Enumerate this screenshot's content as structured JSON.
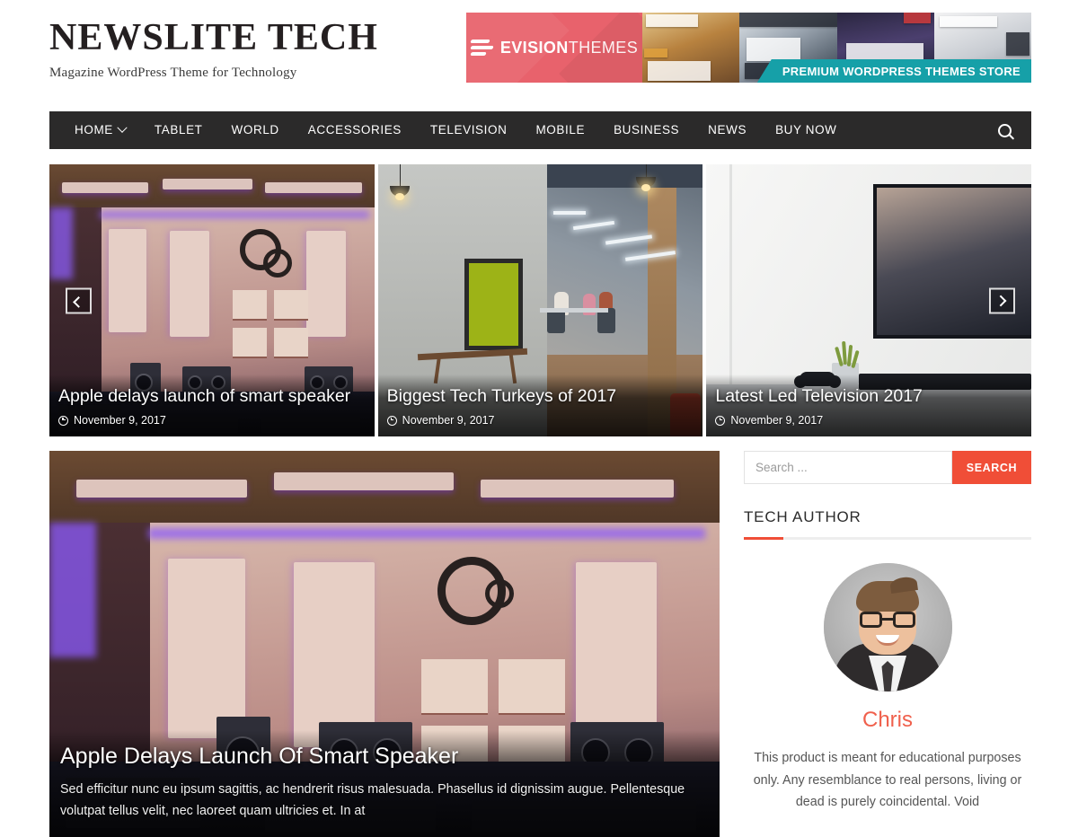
{
  "header": {
    "site_title": "NEWSLITE TECH",
    "site_description": "Magazine WordPress Theme for Technology",
    "ad": {
      "logo_bold": "EVISION",
      "logo_light": "THEMES",
      "cta": "PREMIUM WORDPRESS THEMES STORE",
      "icon": "swoosh-icon",
      "left_color": "#e8626c",
      "cta_color": "#16a0a8"
    }
  },
  "nav": {
    "items": [
      {
        "label": "HOME",
        "has_dropdown": true
      },
      {
        "label": "TABLET",
        "has_dropdown": false
      },
      {
        "label": "WORLD",
        "has_dropdown": false
      },
      {
        "label": "ACCESSORIES",
        "has_dropdown": false
      },
      {
        "label": "TELEVISION",
        "has_dropdown": false
      },
      {
        "label": "MOBILE",
        "has_dropdown": false
      },
      {
        "label": "BUSINESS",
        "has_dropdown": false
      },
      {
        "label": "NEWS",
        "has_dropdown": false
      },
      {
        "label": "BUY NOW",
        "has_dropdown": false
      }
    ],
    "search_icon": "search-icon",
    "background": "#2b2a2a"
  },
  "slider": {
    "prev_icon": "chevron-left-icon",
    "next_icon": "chevron-right-icon",
    "slides": [
      {
        "title": "Apple delays launch of smart speaker",
        "date": "November 9, 2017",
        "date_icon": "clock-icon",
        "image_alt": "recording studio with purple lighting, speakers and acoustic panels"
      },
      {
        "title": "Biggest Tech Turkeys of 2017",
        "date": "November 9, 2017",
        "date_icon": "clock-icon",
        "image_alt": "open plan office interior with green poster and pendant lights"
      },
      {
        "title": "Latest Led Television 2017",
        "date": "November 9, 2017",
        "date_icon": "clock-icon",
        "image_alt": "flat screen television on white stand with plant and game controller"
      }
    ]
  },
  "feature": {
    "title": "Apple Delays Launch Of Smart Speaker",
    "excerpt": "Sed efficitur nunc eu ipsum sagittis, ac hendrerit risus malesuada. Phasellus id dignissim augue. Pellentesque volutpat tellus velit, nec laoreet quam ultricies et. In at",
    "image_alt": "recording studio with purple lighting and studio monitors"
  },
  "sidebar": {
    "search": {
      "placeholder": "Search ...",
      "value": "",
      "button_label": "SEARCH",
      "button_color": "#f04e37"
    },
    "author_widget": {
      "title": "TECH AUTHOR",
      "accent_color": "#f04e37",
      "avatar_alt": "portrait of smiling man with glasses in a suit",
      "name": "Chris",
      "name_color": "#f0604c",
      "description": "This product is meant for educational purposes only. Any resemblance to real persons, living or dead is purely coincidental. Void"
    }
  }
}
